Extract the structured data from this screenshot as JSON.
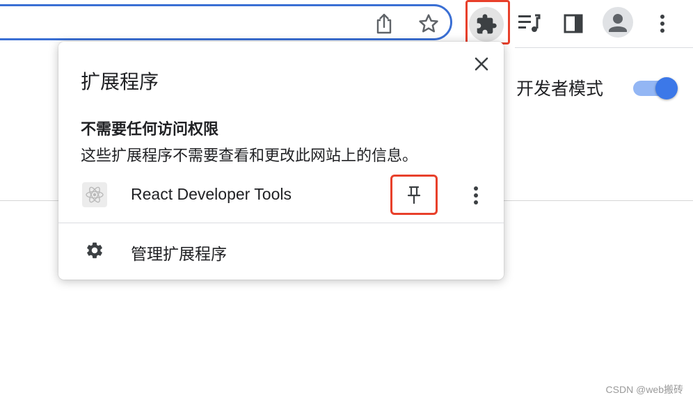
{
  "toolbar": {
    "icons": {
      "share": "share-icon",
      "bookmark": "star-icon",
      "extensions": "puzzle-icon",
      "reading_list": "playlist-icon",
      "side_panel": "side-panel-icon",
      "profile": "person-icon",
      "menu": "more-vert-icon"
    }
  },
  "page": {
    "dev_mode_label": "开发者模式",
    "dev_mode_on": true
  },
  "popup": {
    "title": "扩展程序",
    "section_heading": "不需要任何访问权限",
    "section_desc": "这些扩展程序不需要查看和更改此网站上的信息。",
    "extensions": [
      {
        "name": "React Developer Tools",
        "icon": "react-icon",
        "pinned": false
      }
    ],
    "manage_label": "管理扩展程序"
  },
  "watermark": "CSDN @web搬砖",
  "colors": {
    "accent": "#3c78e8",
    "highlight": "#e8402b",
    "omnibox_border": "#3a6fd4"
  }
}
